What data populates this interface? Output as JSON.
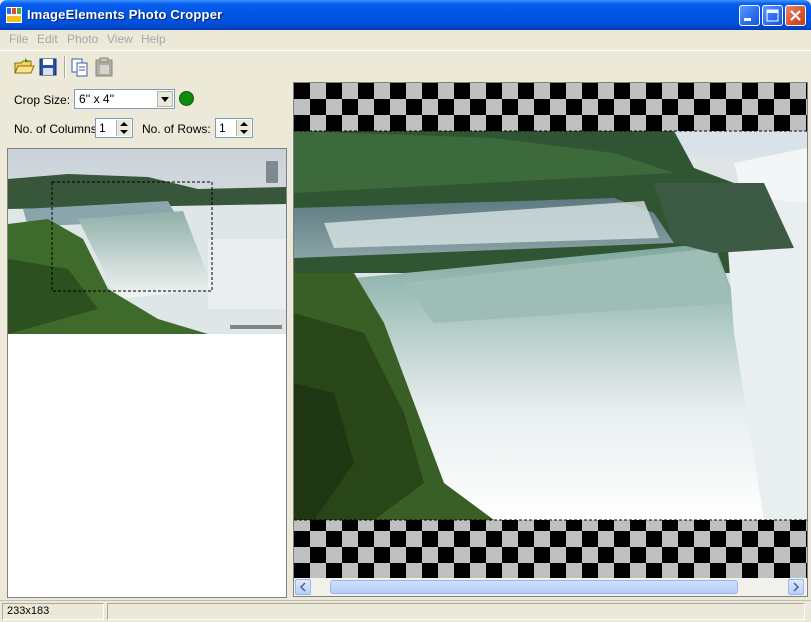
{
  "window": {
    "title": "ImageElements Photo Cropper"
  },
  "menu": {
    "items": [
      "File",
      "Edit",
      "Photo",
      "View",
      "Help"
    ]
  },
  "toolbar": {
    "tools": [
      "open-folder-icon",
      "save-icon",
      "copy-icon",
      "paste-icon"
    ]
  },
  "crop": {
    "size_label": "Crop Size:",
    "size_value": "6'' x 4''",
    "columns_label": "No. of Columns:",
    "columns_value": "1",
    "rows_label": "No. of Rows:",
    "rows_value": "1"
  },
  "status": {
    "dimensions": "233x183"
  },
  "colors": {
    "title_bar": "#0054e3",
    "status_dot": "#118a11"
  }
}
